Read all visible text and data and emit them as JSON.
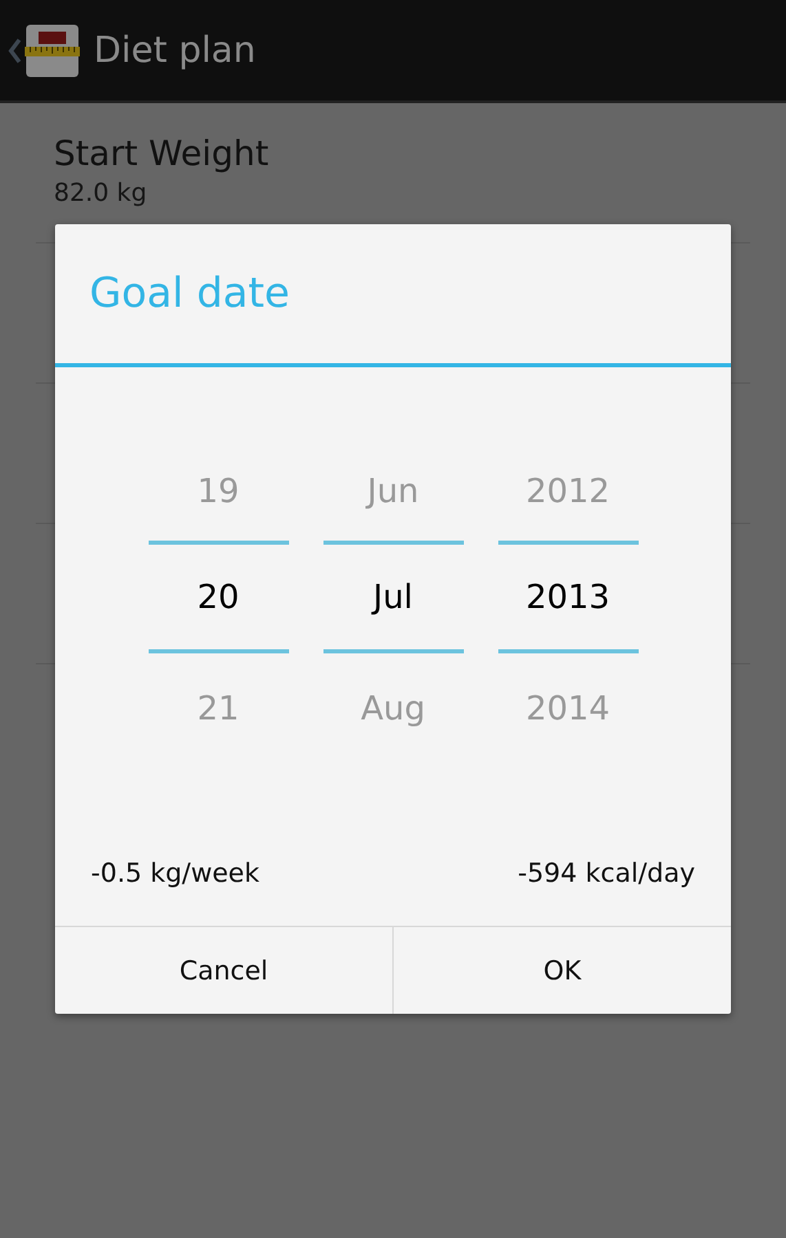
{
  "action_bar": {
    "title": "Diet plan"
  },
  "list": [
    {
      "title": "Start Weight",
      "value": "82.0 kg"
    }
  ],
  "dialog": {
    "title": "Goal date",
    "columns": [
      {
        "items": [
          {
            "label": "19",
            "selected": false
          },
          {
            "label": "20",
            "selected": true
          },
          {
            "label": "21",
            "selected": false
          }
        ]
      },
      {
        "items": [
          {
            "label": "Jun",
            "selected": false
          },
          {
            "label": "Jul",
            "selected": true
          },
          {
            "label": "Aug",
            "selected": false
          }
        ]
      },
      {
        "items": [
          {
            "label": "2012",
            "selected": false
          },
          {
            "label": "2013",
            "selected": true
          },
          {
            "label": "2014",
            "selected": false
          }
        ]
      }
    ],
    "rate": "-0.5 kg/week",
    "calories": "-594 kcal/day",
    "buttons": [
      "Cancel",
      "OK"
    ]
  }
}
